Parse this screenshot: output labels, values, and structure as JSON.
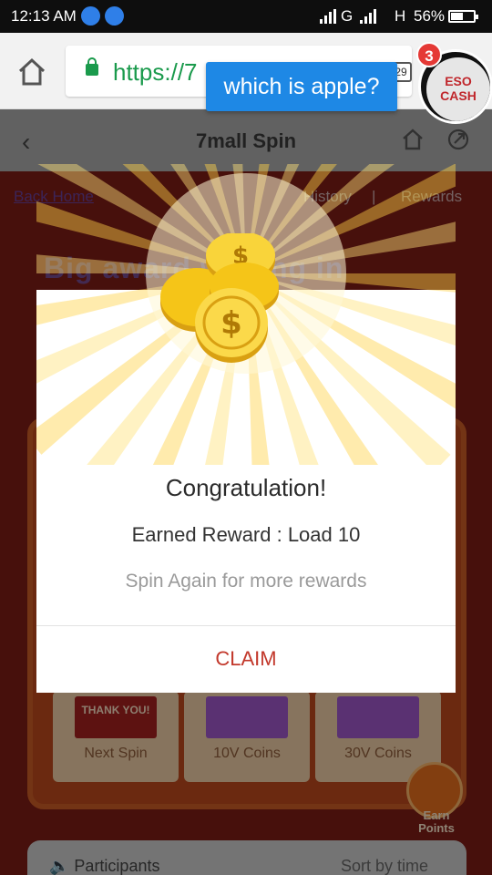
{
  "status_bar": {
    "time": "12:13 AM",
    "network_1": "G",
    "network_2": "H",
    "battery_percent": "56%",
    "battery_level": 0.56
  },
  "browser": {
    "url": "https://7",
    "tab_count": "29",
    "tooltip": "which is apple?",
    "bubble_label_1": "ESO",
    "bubble_label_2": "CASH",
    "badge_count": "3"
  },
  "header": {
    "title": "7mall Spin"
  },
  "game": {
    "back_home": "Back Home",
    "history": "History",
    "separator": "|",
    "rewards": "Rewards",
    "banner": "Big award waiting in",
    "tiles": [
      {
        "label": "Next Spin",
        "image_text": "THANK YOU!"
      },
      {
        "label": "10V Coins"
      },
      {
        "label": "30V Coins"
      }
    ],
    "earn_points": "Earn Points",
    "participants": "Participants",
    "sort": "Sort by time"
  },
  "modal": {
    "title": "Congratulation!",
    "reward": "Earned Reward : Load 10",
    "subtitle": "Spin Again for more rewards",
    "claim": "CLAIM"
  },
  "colors": {
    "accent": "#c2382b",
    "secure": "#1a9a4c",
    "tooltip": "#1e88e5",
    "coin": "#f5c518"
  }
}
